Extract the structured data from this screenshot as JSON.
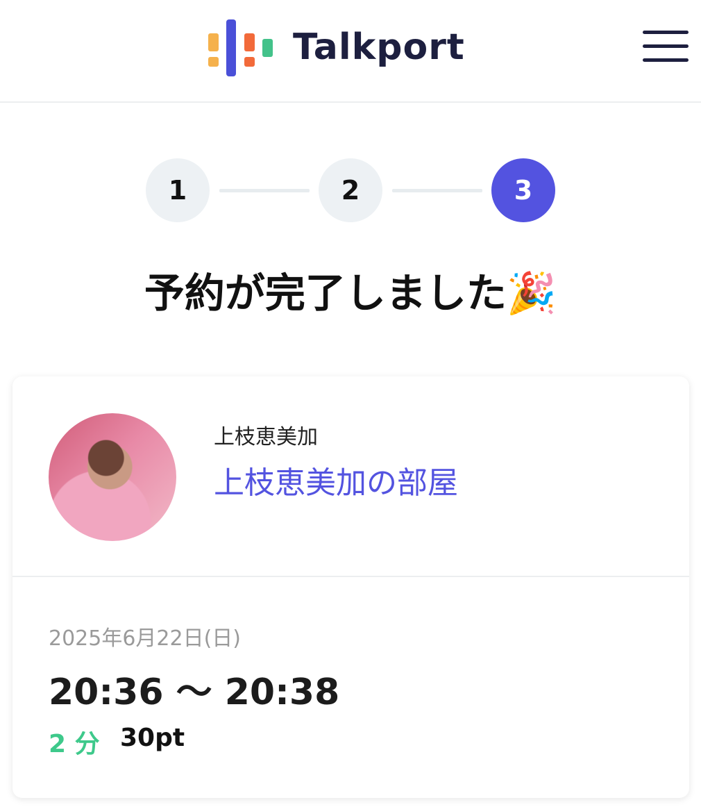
{
  "header": {
    "logo_text": "Talkport",
    "brand_colors": {
      "orange": "#f5b14c",
      "blue": "#4a50d8",
      "red": "#f26a3a",
      "green": "#43c28a"
    },
    "menu_icon": "hamburger-menu-icon"
  },
  "steps": {
    "items": [
      "1",
      "2",
      "3"
    ],
    "current": 3,
    "active_color": "#5353e0"
  },
  "title": "予約が完了しました🎉",
  "card": {
    "owner_name": "上枝恵美加",
    "room_name": "上枝恵美加の部屋",
    "date": "2025年6月22日(日)",
    "time_range": "20:36 〜 20:38",
    "duration": "2 分",
    "points": "30pt",
    "link_color": "#5353e0",
    "duration_color": "#3ec98b"
  }
}
